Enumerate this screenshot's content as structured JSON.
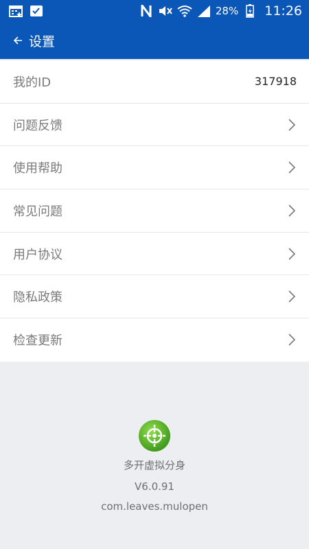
{
  "status_bar": {
    "battery": "28%",
    "time": "11:26",
    "icons": [
      "calendar-icon",
      "check-icon",
      "nfc-icon",
      "mute-icon",
      "wifi-icon",
      "signal-icon",
      "battery-icon"
    ]
  },
  "app_bar": {
    "title": "设置",
    "back_icon": "arrow-left-icon"
  },
  "settings": {
    "items": [
      {
        "label": "我的ID",
        "value": "317918"
      },
      {
        "label": "问题反馈"
      },
      {
        "label": "使用帮助"
      },
      {
        "label": "常见问题"
      },
      {
        "label": "用户协议"
      },
      {
        "label": "隐私政策"
      },
      {
        "label": "检查更新"
      }
    ]
  },
  "about": {
    "app_name": "多开虚拟分身",
    "version": "V6.0.91",
    "package": "com.leaves.mulopen",
    "logo_icon": "app-logo-icon",
    "logo_color": "#5cb82c"
  },
  "colors": {
    "primary": "#0a57b8",
    "background": "#eceef1"
  }
}
